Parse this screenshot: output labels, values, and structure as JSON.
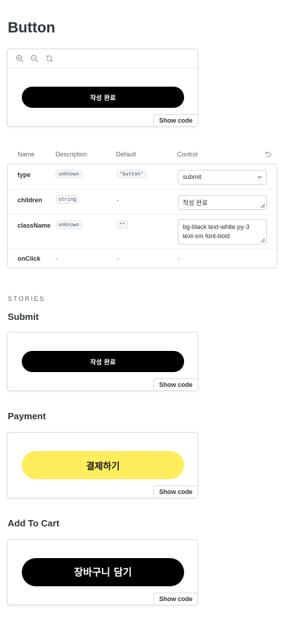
{
  "page": {
    "title": "Button"
  },
  "preview": {
    "toolbar_icons": [
      "zoom-in-icon",
      "zoom-out-icon",
      "reset-zoom-icon"
    ],
    "button_label": "작성 완료",
    "show_code": "Show code"
  },
  "args": {
    "headers": {
      "name": "Name",
      "description": "Description",
      "default": "Default",
      "control": "Control"
    },
    "rows": [
      {
        "name": "type",
        "type": "unknown",
        "default": "\"button\"",
        "control": "submit"
      },
      {
        "name": "children",
        "type": "string",
        "default": "-",
        "control": "작성 완료"
      },
      {
        "name": "className",
        "type": "unknown",
        "default": "\"\"",
        "control": "bg-black text-white py-3 text-sm font-bold"
      },
      {
        "name": "onClick",
        "type": "-",
        "default": "-",
        "control": "-"
      }
    ]
  },
  "stories": {
    "section_label": "STORIES",
    "items": [
      {
        "title": "Submit",
        "button_label": "작성 완료",
        "style": "black",
        "show_code": "Show code"
      },
      {
        "title": "Payment",
        "button_label": "결제하기",
        "style": "yellow",
        "show_code": "Show code"
      },
      {
        "title": "Add To Cart",
        "button_label": "장바구니 담기",
        "style": "black",
        "show_code": "Show code"
      }
    ]
  },
  "colors": {
    "black_button": "#000000",
    "yellow_button": "#ffed5e",
    "text": "#2e3438",
    "border": "#d9dde0"
  }
}
